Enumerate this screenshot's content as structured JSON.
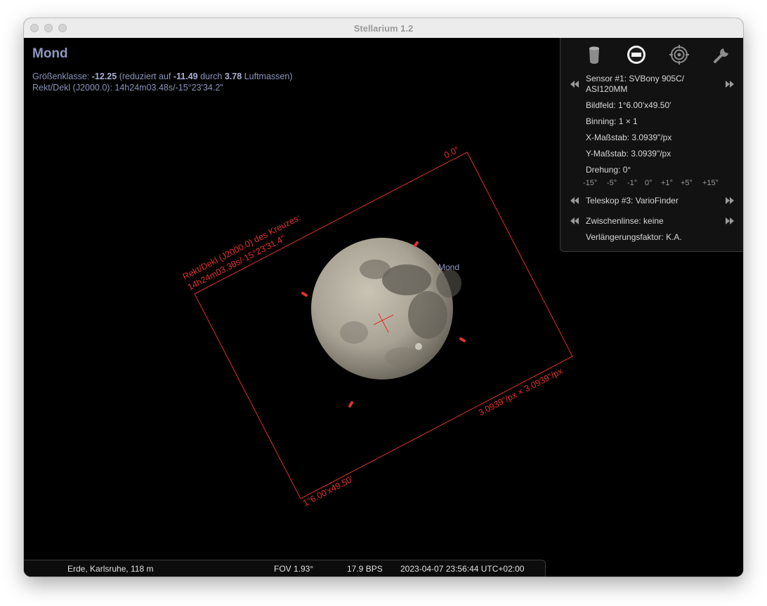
{
  "window": {
    "title": "Stellarium 1.2"
  },
  "object": {
    "name": "Mond",
    "magnitude": {
      "label": "Größenklasse:",
      "value": "-12.25",
      "reduced_prefix": "(reduziert auf",
      "reduced_value": "-11.49",
      "through": "durch",
      "airmass_value": "3.78",
      "airmass_suffix": "Luftmassen)"
    },
    "radec": "Rekt/Dekl (J2000.0): 14h24m03.48s/-15°23'34.2\""
  },
  "sky": {
    "moon_label": "Mond",
    "frame_rotation_label": "0.0°",
    "crosshair_label_line1": "Rekt/Dekl (J2000.0) des Kreuzes:",
    "crosshair_label_line2": "14h24m03.38s/-15°23'31.4\"",
    "scale_label": "3.0939\"/px × 3.0939\"/px",
    "fov_label": "1°6.00'x49.50'"
  },
  "ocular_panel": {
    "icons": [
      "ocular-icon",
      "sensor-icon",
      "telrad-icon",
      "wrench-icon"
    ],
    "sensor": "Sensor #1: SVBony 905C/",
    "sensor_line2": "ASI120MM",
    "field": "Bildfeld: 1°6.00′x49.50′",
    "binning": "Binning: 1 × 1",
    "x_scale": "X-Maßstab: 3.0939\"/px",
    "y_scale": "Y-Maßstab: 3.0939\"/px",
    "rotation": "Drehung: 0°",
    "rotation_steps": [
      "-15°",
      "-5°",
      "-1°",
      "0°",
      "+1°",
      "+5°",
      "+15°"
    ],
    "telescope": "Teleskop #3: VarioFinder",
    "lens": "Zwischenlinse: keine",
    "extension": "Verlängerungsfaktor: K.A."
  },
  "status_bar": {
    "location": "Erde, Karlsruhe, 118 m",
    "fov": "FOV 1.93°",
    "fps": "17.9 BPS",
    "datetime": "2023-04-07 23:56:44 UTC+02:00"
  },
  "colors": {
    "overlay_red": "#e0312f",
    "info_blue": "#8a93b8"
  }
}
